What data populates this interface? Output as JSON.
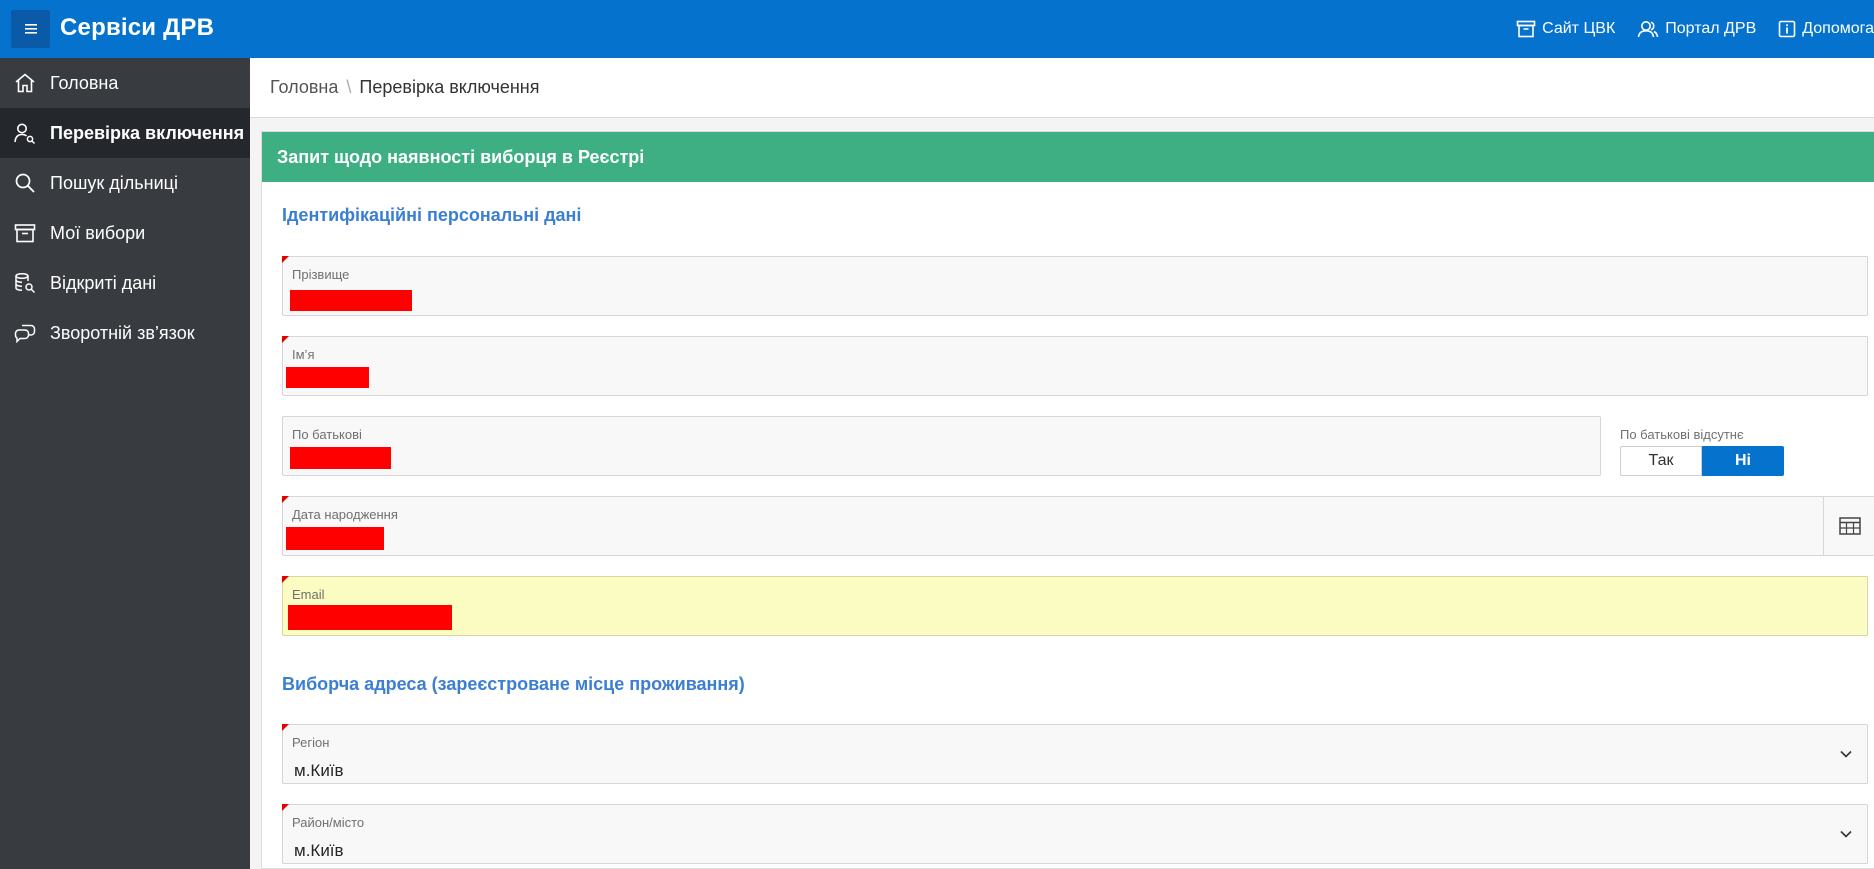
{
  "header": {
    "title": "Сервіси ДРВ",
    "links": [
      {
        "label": "Сайт ЦВК",
        "icon": "archive-box-icon"
      },
      {
        "label": "Портал ДРВ",
        "icon": "users-icon"
      },
      {
        "label": "Допомога",
        "icon": "info-icon"
      }
    ]
  },
  "sidebar": {
    "items": [
      {
        "label": "Головна",
        "icon": "home-icon"
      },
      {
        "label": "Перевірка включення",
        "icon": "user-search-icon",
        "active": true
      },
      {
        "label": "Пошук дільниці",
        "icon": "search-icon"
      },
      {
        "label": "Мої вибори",
        "icon": "archive-icon"
      },
      {
        "label": "Відкриті дані",
        "icon": "database-search-icon"
      },
      {
        "label": "Зворотній зв’язок",
        "icon": "chat-bubbles-icon"
      }
    ]
  },
  "breadcrumb": {
    "home": "Головна",
    "separator": "\\",
    "current": "Перевірка включення"
  },
  "region": {
    "title": "Запит щодо наявності виборця в Реєстрі",
    "section_personal": "Ідентифікаційні персональні дані",
    "section_address": "Виборча адреса (зареєстроване місце проживання)"
  },
  "form": {
    "surname_label": "Прізвище",
    "name_label": "Ім’я",
    "patronymic_label": "По батькові",
    "no_patronymic_label": "По батькові відсутнє",
    "toggle_yes": "Так",
    "toggle_no": "Ні",
    "birthdate_label": "Дата народження",
    "email_label": "Email",
    "region_label": "Регіон",
    "region_value": "м.Київ",
    "district_label": "Район/місто",
    "district_value": "м.Київ"
  },
  "colors": {
    "header": "#0572ce",
    "sidebar": "#383c41",
    "region_header": "#3daf82",
    "section_title": "#3a7fd4",
    "redaction": "#ff0000",
    "email_highlight": "#fafcc1"
  }
}
